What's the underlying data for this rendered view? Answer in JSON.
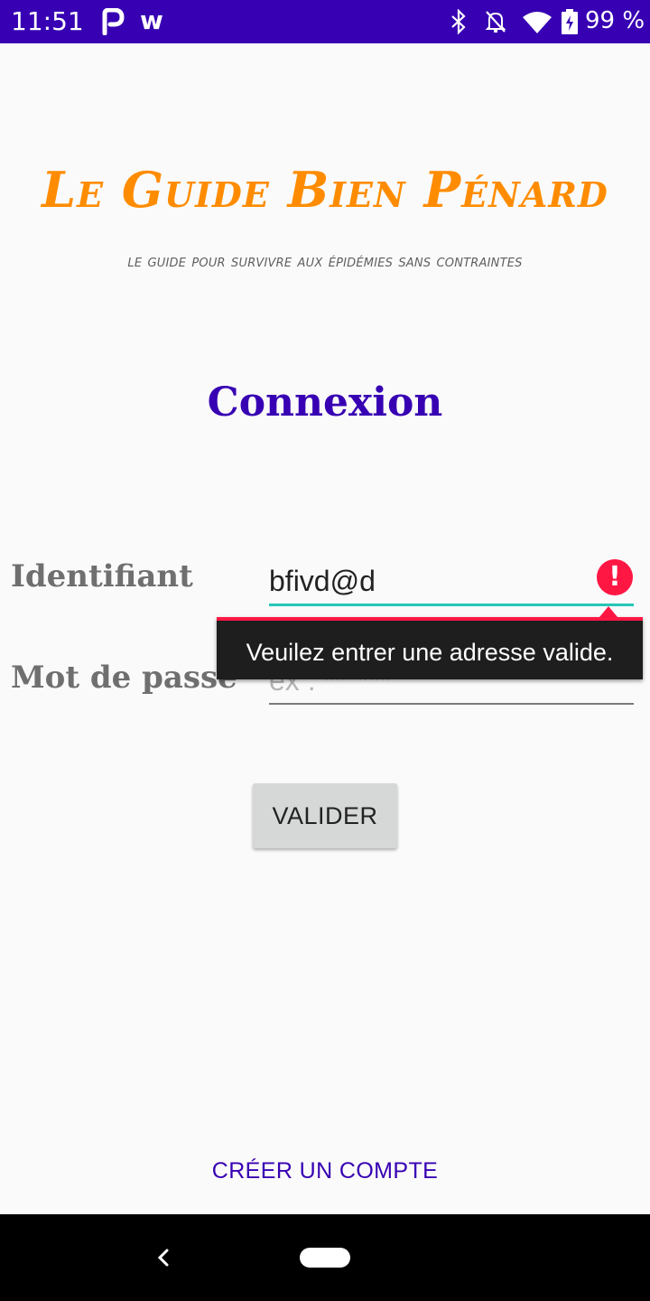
{
  "status_bar": {
    "time": "11:51",
    "app_icon_p": "P",
    "app_icon_w": "w",
    "battery_percent": "99 %",
    "icons": [
      "bluetooth-icon",
      "notifications-off-icon",
      "wifi-icon",
      "battery-icon"
    ]
  },
  "header": {
    "title": "Le Guide Bien Pénard",
    "subtitle": "le guide pour survivre aux épidémies sans contraintes",
    "page_title": "Connexion"
  },
  "form": {
    "identifier_label": "Identifiant",
    "identifier_value": "bfivd@d",
    "password_label": "Mot de passe",
    "password_placeholder": "ex : ******",
    "error_message": "Veuilez entrer une adresse valide.",
    "error_icon": "!",
    "submit_label": "VALIDER"
  },
  "footer": {
    "create_account": "CRÉER UN COMPTE"
  },
  "colors": {
    "status_bar": "#3700b3",
    "title": "#ff8c00",
    "accent": "#3700b3",
    "error": "#ff1744",
    "field_focus": "#26c6b6"
  }
}
